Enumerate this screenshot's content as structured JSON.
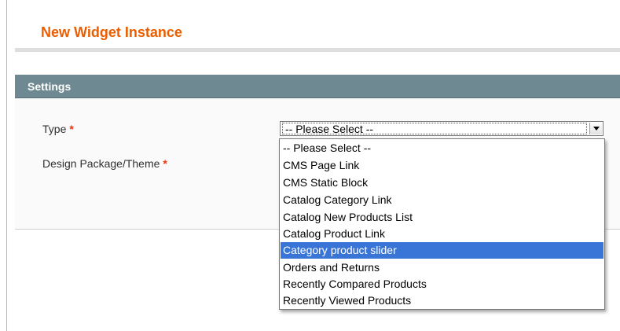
{
  "page": {
    "title": "New Widget Instance"
  },
  "settings": {
    "section_title": "Settings",
    "type_label": "Type",
    "design_label": "Design Package/Theme",
    "required_mark": "*"
  },
  "type_select": {
    "value": "-- Please Select --",
    "options": [
      "-- Please Select --",
      "CMS Page Link",
      "CMS Static Block",
      "Catalog Category Link",
      "Catalog New Products List",
      "Catalog Product Link",
      "Category product slider",
      "Orders and Returns",
      "Recently Compared Products",
      "Recently Viewed Products"
    ],
    "highlighted_option": "Category product slider"
  },
  "colors": {
    "title": "#eb5e00",
    "section_header": "#6f8992",
    "required": "#eb340a",
    "highlight": "#3875d7"
  },
  "icons": {
    "select_arrow": "chevron-down-icon"
  }
}
